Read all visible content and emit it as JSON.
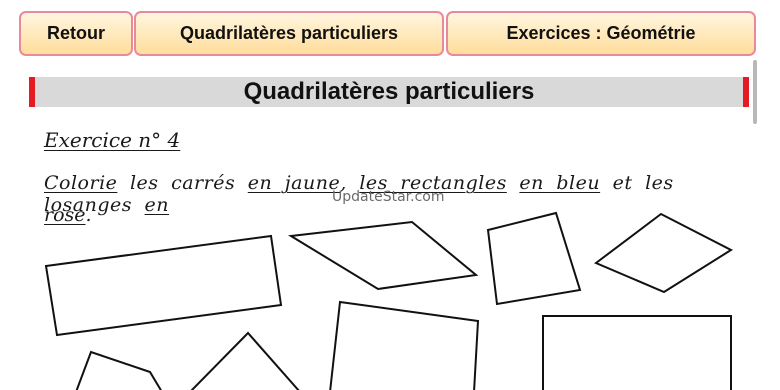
{
  "nav": {
    "retour": "Retour",
    "quadrilateres": "Quadrilatères particuliers",
    "exercices": "Exercices : Géométrie"
  },
  "page": {
    "title": "Quadrilatères particuliers"
  },
  "exercise": {
    "heading": "Exercice n° 4",
    "instruction": {
      "colorie": "Colorie",
      "les_carres": "les carrés",
      "en_jaune": "en jaune",
      "les_rectangles": "les rectangles",
      "en_bleu": "en bleu",
      "et_les_losanges": "et les losanges",
      "en": "en",
      "rose": "rose",
      "period": "."
    }
  },
  "watermark": "UpdateStar.com"
}
